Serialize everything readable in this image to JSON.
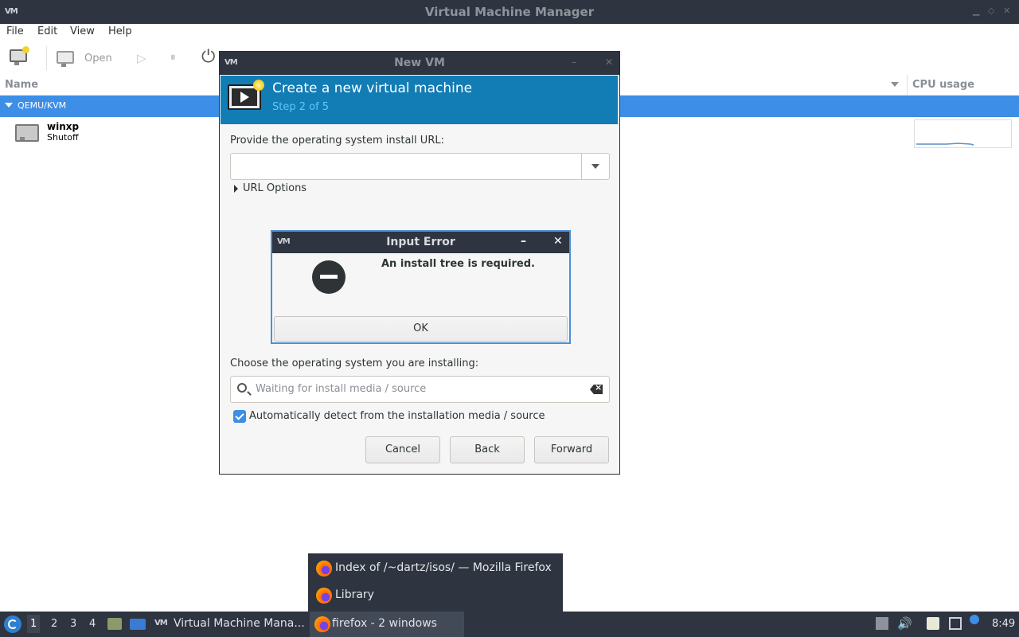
{
  "main_window": {
    "title": "Virtual Machine Manager",
    "logo_text": "VM",
    "menu": [
      "File",
      "Edit",
      "View",
      "Help"
    ],
    "toolbar": {
      "open_label": "Open"
    },
    "columns": {
      "name": "Name",
      "cpu": "CPU usage"
    },
    "connection": "QEMU/KVM",
    "vms": [
      {
        "name": "winxp",
        "state": "Shutoff"
      }
    ]
  },
  "new_vm_dialog": {
    "window_title": "New VM",
    "header_title": "Create a new virtual machine",
    "step": "Step 2 of 5",
    "url_label": "Provide the operating system install URL:",
    "url_value": "",
    "url_options": "URL Options",
    "os_label": "Choose the operating system you are installing:",
    "os_placeholder": "Waiting for install media / source",
    "auto_detect_label": "Automatically detect from the installation media / source",
    "auto_detect_checked": true,
    "buttons": {
      "cancel": "Cancel",
      "back": "Back",
      "forward": "Forward"
    }
  },
  "error_dialog": {
    "title": "Input Error",
    "message": "An install tree is required.",
    "ok": "OK"
  },
  "firefox_popup": {
    "items": [
      "Index of /~dartz/isos/ — Mozilla Firefox",
      "Library"
    ]
  },
  "taskbar": {
    "workspaces": [
      "1",
      "2",
      "3",
      "4"
    ],
    "active_workspace": "1",
    "tasks": [
      {
        "label": "Virtual Machine Mana...",
        "active": false
      },
      {
        "label": "firefox - 2 windows",
        "active": true
      }
    ],
    "clock": "8:49"
  },
  "colors": {
    "selection_blue": "#3d8ee6",
    "header_blue": "#127cb5",
    "step_text": "#60c6f4",
    "panel_dark": "#2e3440"
  }
}
